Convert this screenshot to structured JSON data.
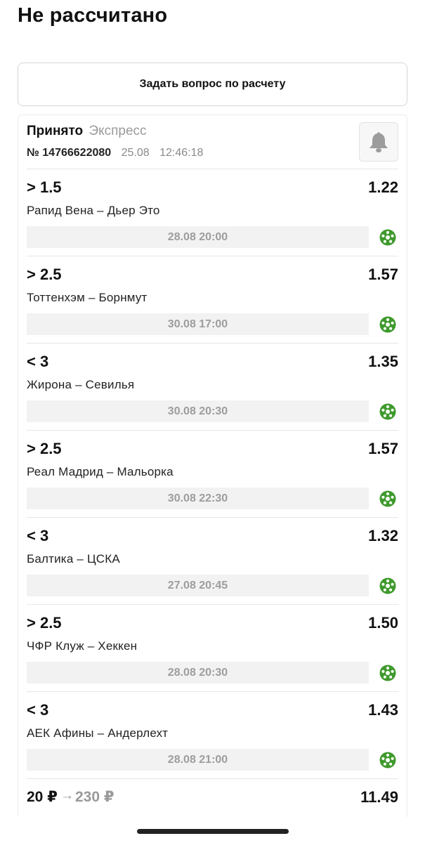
{
  "header": {
    "title": "Не рассчитано"
  },
  "ask_button": {
    "label": "Задать вопрос по расчету"
  },
  "bet": {
    "status": "Принято",
    "type": "Экспресс",
    "number": "№ 14766622080",
    "date": "25.08",
    "time": "12:46:18",
    "bell_icon": "bell-icon"
  },
  "events": [
    {
      "outcome": "> 1.5",
      "odds": "1.22",
      "match": "Рапид Вена – Дьер Это",
      "datetime": "28.08 20:00",
      "sport_icon": "football-icon"
    },
    {
      "outcome": "> 2.5",
      "odds": "1.57",
      "match": "Тоттенхэм – Борнмут",
      "datetime": "30.08 17:00",
      "sport_icon": "football-icon"
    },
    {
      "outcome": "< 3",
      "odds": "1.35",
      "match": "Жирона – Севилья",
      "datetime": "30.08 20:30",
      "sport_icon": "football-icon"
    },
    {
      "outcome": "> 2.5",
      "odds": "1.57",
      "match": "Реал Мадрид – Мальорка",
      "datetime": "30.08 22:30",
      "sport_icon": "football-icon"
    },
    {
      "outcome": "< 3",
      "odds": "1.32",
      "match": "Балтика – ЦСКА",
      "datetime": "27.08 20:45",
      "sport_icon": "football-icon"
    },
    {
      "outcome": "> 2.5",
      "odds": "1.50",
      "match": "ЧФР Клуж – Хеккен",
      "datetime": "28.08 20:30",
      "sport_icon": "football-icon"
    },
    {
      "outcome": "< 3",
      "odds": "1.43",
      "match": "АЕК Афины – Андерлехт",
      "datetime": "28.08 21:00",
      "sport_icon": "football-icon"
    }
  ],
  "footer": {
    "stake": "20 ₽",
    "arrow": "→",
    "payout": "230 ₽",
    "total_odds": "11.49"
  },
  "colors": {
    "accent_green": "#3f9a2c",
    "muted_text": "#9a9a9a",
    "datebar_bg": "#f2f2f2"
  }
}
